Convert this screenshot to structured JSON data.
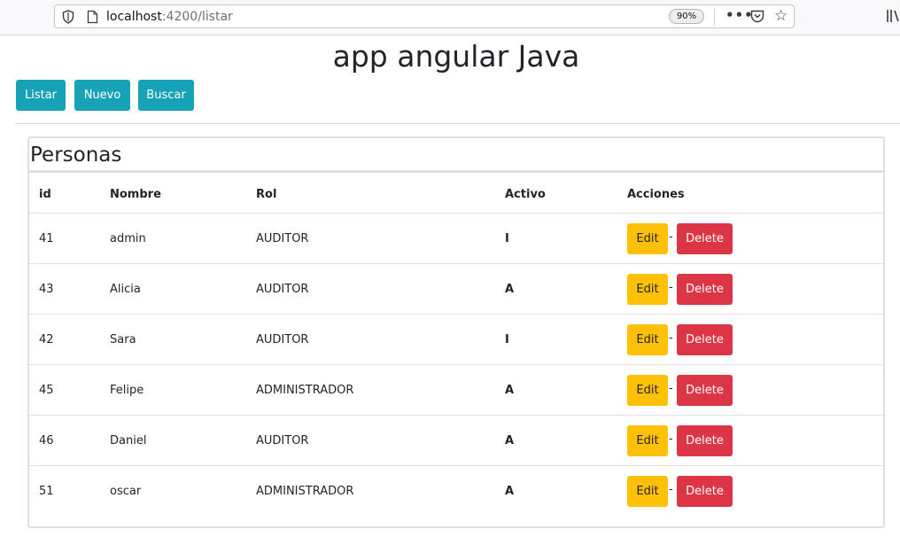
{
  "browser": {
    "url_host": "localhost",
    "url_path": ":4200/listar",
    "zoom": "90%"
  },
  "app": {
    "title": "app angular Java"
  },
  "nav": {
    "listar": "Listar",
    "nuevo": "Nuevo",
    "buscar": "Buscar"
  },
  "card": {
    "title": "Personas"
  },
  "table": {
    "headers": {
      "id": "id",
      "nombre": "Nombre",
      "rol": "Rol",
      "activo": "Activo",
      "acciones": "Acciones"
    },
    "rows": [
      {
        "id": "41",
        "nombre": "admin",
        "rol": "AUDITOR",
        "activo": "I"
      },
      {
        "id": "43",
        "nombre": "Alicia",
        "rol": "AUDITOR",
        "activo": "A"
      },
      {
        "id": "42",
        "nombre": "Sara",
        "rol": "AUDITOR",
        "activo": "I"
      },
      {
        "id": "45",
        "nombre": "Felipe",
        "rol": "ADMINISTRADOR",
        "activo": "A"
      },
      {
        "id": "46",
        "nombre": "Daniel",
        "rol": "AUDITOR",
        "activo": "A"
      },
      {
        "id": "51",
        "nombre": "oscar",
        "rol": "ADMINISTRADOR",
        "activo": "A"
      }
    ],
    "edit_label": "Edit",
    "separator": "-",
    "delete_label": "Delete"
  },
  "colors": {
    "info": "#17a2b8",
    "warning": "#ffc107",
    "danger": "#dc3545"
  },
  "icons": [
    "shield-icon",
    "page-icon",
    "more-icon",
    "pocket-icon",
    "bookmark-star-icon",
    "library-icon"
  ]
}
